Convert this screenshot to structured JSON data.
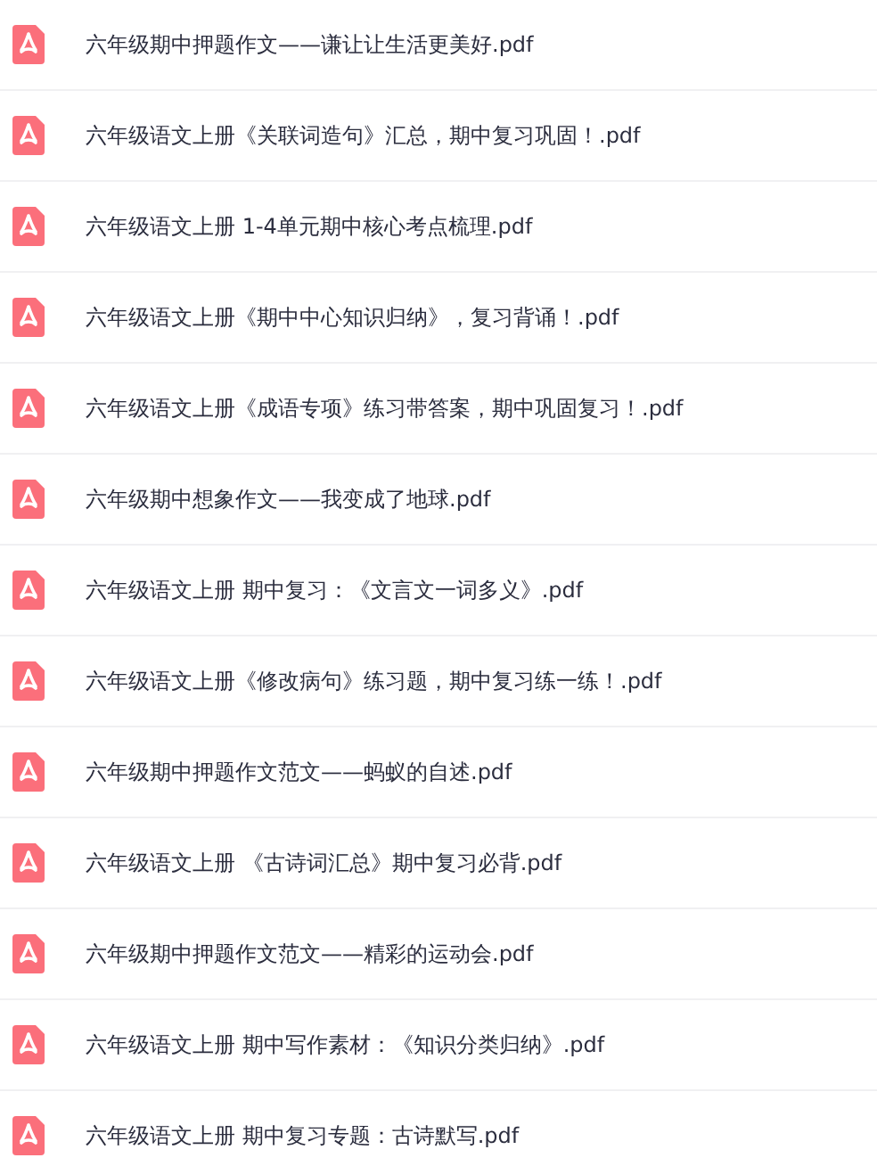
{
  "files": [
    {
      "name": "六年级期中押题作文——谦让让生活更美好.pdf"
    },
    {
      "name": "六年级语文上册《关联词造句》汇总，期中复习巩固！.pdf"
    },
    {
      "name": "六年级语文上册 1-4单元期中核心考点梳理.pdf"
    },
    {
      "name": "六年级语文上册《期中中心知识归纳》，复习背诵！.pdf"
    },
    {
      "name": "六年级语文上册《成语专项》练习带答案，期中巩固复习！.pdf"
    },
    {
      "name": "六年级期中想象作文——我变成了地球.pdf"
    },
    {
      "name": "六年级语文上册 期中复习：《文言文一词多义》.pdf"
    },
    {
      "name": "六年级语文上册《修改病句》练习题，期中复习练一练！.pdf"
    },
    {
      "name": "六年级期中押题作文范文——蚂蚁的自述.pdf"
    },
    {
      "name": "六年级语文上册 《古诗词汇总》期中复习必背.pdf"
    },
    {
      "name": "六年级期中押题作文范文——精彩的运动会.pdf"
    },
    {
      "name": "六年级语文上册 期中写作素材：《知识分类归纳》.pdf"
    },
    {
      "name": "六年级语文上册 期中复习专题：古诗默写.pdf"
    }
  ]
}
